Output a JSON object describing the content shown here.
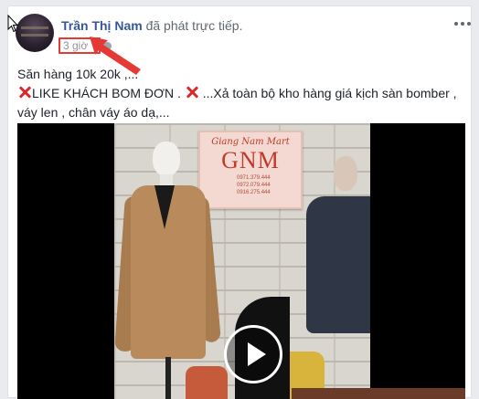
{
  "post": {
    "author": "Trần Thị Nam",
    "action": "đã phát trực tiếp.",
    "time": "3 giờ",
    "privacy_icon": "globe-icon",
    "menu_icon": "more-options-icon",
    "text_line1": "Săn hàng 10k 20k ,...",
    "text_line2_a": "LIKE KHÁCH BOM ĐƠN . ",
    "text_line2_b": " ...Xả toàn bộ kho hàng giá kịch sàn bomber ,",
    "text_line3": "váy len , chân váy áo dạ,..."
  },
  "video": {
    "sign_title": "Giang Nam Mart",
    "sign_logo": "GNM",
    "sign_phone1": "0971.379.444",
    "sign_phone2": "0972.079.444",
    "sign_phone3": "0916.275.444",
    "play_icon": "play-icon"
  },
  "annotation": {
    "highlight_color": "#e53935",
    "arrow_icon": "red-arrow-icon"
  }
}
